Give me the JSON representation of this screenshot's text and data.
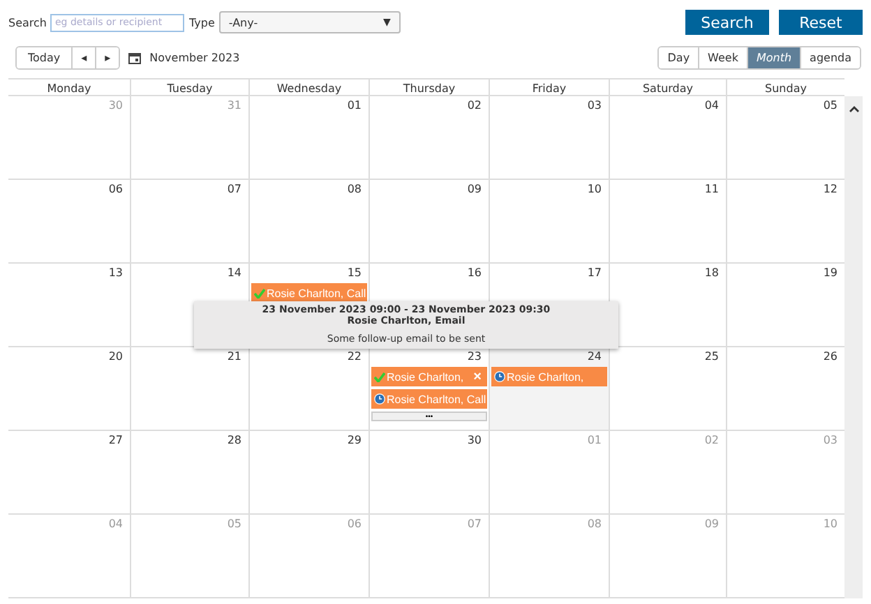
{
  "search": {
    "label": "Search",
    "placeholder": "eg details or recipient"
  },
  "type_filter": {
    "label": "Type",
    "value": "-Any-",
    "caret": "▼"
  },
  "buttons": [
    "Search",
    "Reset"
  ],
  "nav": {
    "today": "Today",
    "prev": "◂",
    "next": "▸",
    "period": "November 2023"
  },
  "views": [
    {
      "label": "Day",
      "selected": false
    },
    {
      "label": "Week",
      "selected": false
    },
    {
      "label": "Month",
      "selected": true
    },
    {
      "label": "agenda",
      "selected": false
    }
  ],
  "weekdays": [
    "Monday",
    "Tuesday",
    "Wednesday",
    "Thursday",
    "Friday",
    "Saturday",
    "Sunday"
  ],
  "weeks": [
    [
      {
        "label": "30",
        "muted": true
      },
      {
        "label": "31",
        "muted": true
      },
      {
        "label": "01",
        "muted": false
      },
      {
        "label": "02",
        "muted": false
      },
      {
        "label": "03",
        "muted": false
      },
      {
        "label": "04",
        "muted": false
      },
      {
        "label": "05",
        "muted": false
      }
    ],
    [
      {
        "label": "06",
        "muted": false
      },
      {
        "label": "07",
        "muted": false
      },
      {
        "label": "08",
        "muted": false
      },
      {
        "label": "09",
        "muted": false
      },
      {
        "label": "10",
        "muted": false
      },
      {
        "label": "11",
        "muted": false
      },
      {
        "label": "12",
        "muted": false
      }
    ],
    [
      {
        "label": "13",
        "muted": false
      },
      {
        "label": "14",
        "muted": false
      },
      {
        "label": "15",
        "muted": false,
        "events": [
          {
            "kind": "done",
            "text": "Rosie Charlton, Call"
          }
        ]
      },
      {
        "label": "16",
        "muted": false
      },
      {
        "label": "17",
        "muted": false
      },
      {
        "label": "18",
        "muted": false
      },
      {
        "label": "19",
        "muted": false
      }
    ],
    [
      {
        "label": "20",
        "muted": false
      },
      {
        "label": "21",
        "muted": false
      },
      {
        "label": "22",
        "muted": false
      },
      {
        "label": "23",
        "muted": false,
        "events": [
          {
            "kind": "done",
            "text": "Rosie Charlton,",
            "close": "×"
          },
          {
            "kind": "scheduled",
            "text": "Rosie Charlton, Call"
          }
        ],
        "more": "•••"
      },
      {
        "label": "24",
        "muted": false,
        "shaded": true,
        "events": [
          {
            "kind": "scheduled",
            "text": "Rosie Charlton,"
          }
        ]
      },
      {
        "label": "25",
        "muted": false
      },
      {
        "label": "26",
        "muted": false
      }
    ],
    [
      {
        "label": "27",
        "muted": false
      },
      {
        "label": "28",
        "muted": false
      },
      {
        "label": "29",
        "muted": false
      },
      {
        "label": "30",
        "muted": false
      },
      {
        "label": "01",
        "muted": true
      },
      {
        "label": "02",
        "muted": true
      },
      {
        "label": "03",
        "muted": true
      }
    ],
    [
      {
        "label": "04",
        "muted": true
      },
      {
        "label": "05",
        "muted": true
      },
      {
        "label": "06",
        "muted": true
      },
      {
        "label": "07",
        "muted": true
      },
      {
        "label": "08",
        "muted": true
      },
      {
        "label": "09",
        "muted": true
      },
      {
        "label": "10",
        "muted": true
      }
    ]
  ],
  "tooltip": {
    "time": "23 November 2023 09:00 - 23 November 2023 09:30",
    "title": "Rosie Charlton, Email",
    "description": "Some follow-up email to be sent"
  }
}
